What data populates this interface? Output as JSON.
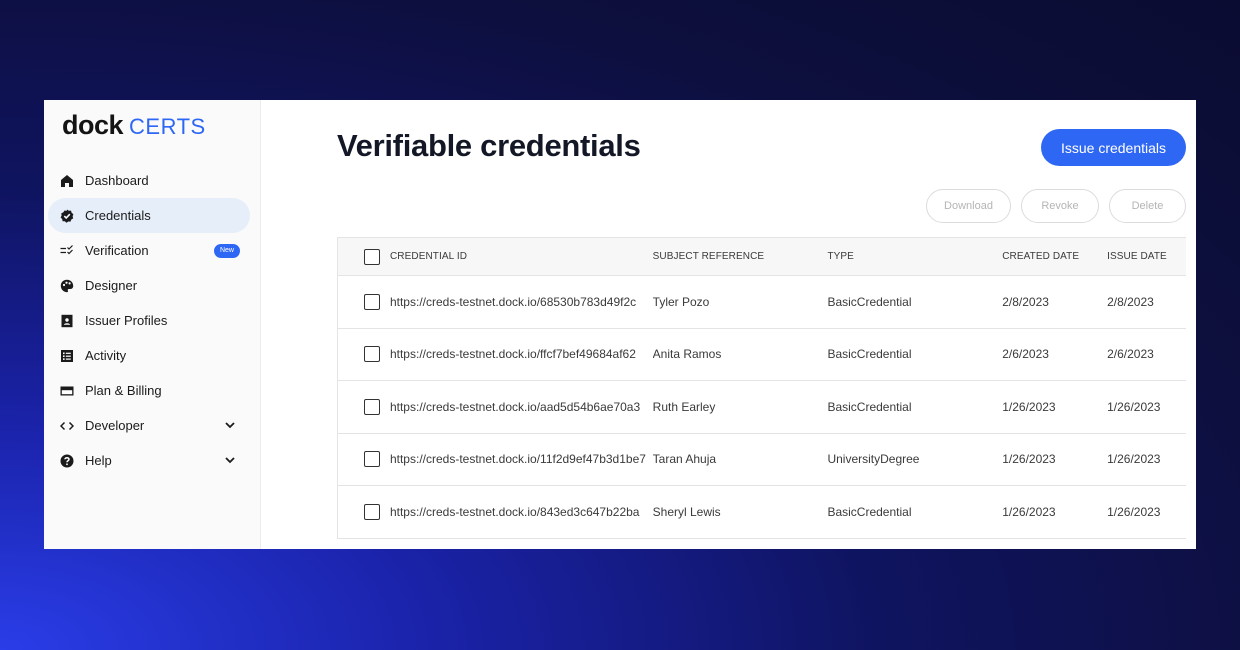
{
  "brand": {
    "name": "dock",
    "product": "CERTS",
    "accent": "#2f67f5"
  },
  "sidebar": {
    "items": [
      {
        "label": "Dashboard",
        "icon": "home-icon"
      },
      {
        "label": "Credentials",
        "icon": "badge-check-icon",
        "active": true
      },
      {
        "label": "Verification",
        "icon": "verification-list-icon",
        "badge": "New"
      },
      {
        "label": "Designer",
        "icon": "palette-icon"
      },
      {
        "label": "Issuer Profiles",
        "icon": "profile-card-icon"
      },
      {
        "label": "Activity",
        "icon": "activity-list-icon"
      },
      {
        "label": "Plan & Billing",
        "icon": "credit-card-icon"
      },
      {
        "label": "Developer",
        "icon": "code-icon",
        "expandable": true
      },
      {
        "label": "Help",
        "icon": "help-icon",
        "expandable": true
      }
    ]
  },
  "main": {
    "title": "Verifiable credentials",
    "primary_action": "Issue credentials",
    "actions": {
      "download": "Download",
      "revoke": "Revoke",
      "delete": "Delete"
    }
  },
  "table": {
    "headers": {
      "credential_id": "CREDENTIAL ID",
      "subject": "SUBJECT REFERENCE",
      "type": "TYPE",
      "created": "CREATED DATE",
      "issue": "ISSUE DATE"
    },
    "rows": [
      {
        "id": "https://creds-testnet.dock.io/68530b783d49f2c",
        "subject": "Tyler Pozo",
        "type": "BasicCredential",
        "created": "2/8/2023",
        "issue": "2/8/2023"
      },
      {
        "id": "https://creds-testnet.dock.io/ffcf7bef49684af62",
        "subject": "Anita Ramos",
        "type": "BasicCredential",
        "created": "2/6/2023",
        "issue": "2/6/2023"
      },
      {
        "id": "https://creds-testnet.dock.io/aad5d54b6ae70a3",
        "subject": "Ruth Earley",
        "type": "BasicCredential",
        "created": "1/26/2023",
        "issue": "1/26/2023"
      },
      {
        "id": "https://creds-testnet.dock.io/11f2d9ef47b3d1be7",
        "subject": "Taran Ahuja",
        "type": "UniversityDegree",
        "created": "1/26/2023",
        "issue": "1/26/2023"
      },
      {
        "id": "https://creds-testnet.dock.io/843ed3c647b22ba",
        "subject": "Sheryl Lewis",
        "type": "BasicCredential",
        "created": "1/26/2023",
        "issue": "1/26/2023"
      }
    ]
  }
}
